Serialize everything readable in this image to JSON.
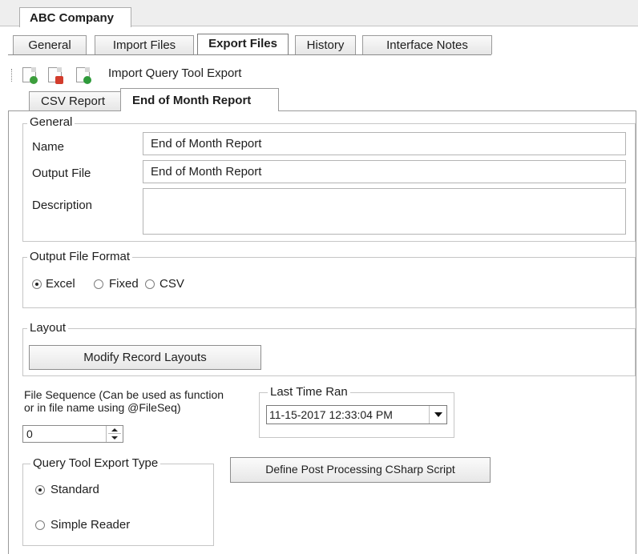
{
  "window": {
    "title": "ABC Company"
  },
  "tabs": [
    {
      "label": "General"
    },
    {
      "label": "Import Files"
    },
    {
      "label": "Export Files",
      "active": true
    },
    {
      "label": "History"
    },
    {
      "label": "Interface Notes"
    }
  ],
  "toolbar": {
    "icons": [
      "add-document-icon",
      "delete-document-icon",
      "import-document-icon"
    ],
    "label": "Import Query Tool Export"
  },
  "subtabs": [
    {
      "label": "CSV Report"
    },
    {
      "label": "End of Month Report",
      "active": true
    }
  ],
  "general": {
    "title": "General",
    "name_label": "Name",
    "name_value": "End of Month Report",
    "output_file_label": "Output File",
    "output_file_value": "End of Month Report",
    "description_label": "Description",
    "description_value": ""
  },
  "output_format": {
    "title": "Output File Format",
    "options": [
      "Excel",
      "Fixed",
      "CSV"
    ],
    "selected": "Excel"
  },
  "layout": {
    "title": "Layout",
    "modify_button": "Modify Record Layouts"
  },
  "file_sequence": {
    "label_line1": "File Sequence (Can be used as function",
    "label_line2": "or in file name using @FileSeq)",
    "value": "0"
  },
  "last_time_ran": {
    "title": "Last Time Ran",
    "value": "11-15-2017 12:33:04 PM"
  },
  "query_tool_export_type": {
    "title": "Query Tool Export Type",
    "options": [
      "Standard",
      "Simple Reader"
    ],
    "selected": "Standard"
  },
  "post_processing_button": "Define Post Processing CSharp Script",
  "colors": {
    "add_icon": "#3c9e3c",
    "delete_icon": "#d23c2c",
    "import_icon": "#2e9a3a"
  }
}
